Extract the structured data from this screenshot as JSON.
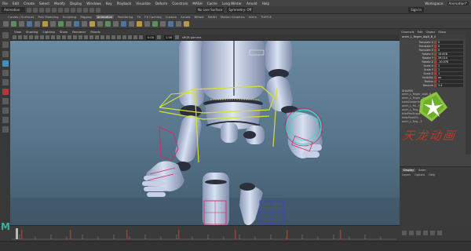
{
  "menubar": {
    "items": [
      "File",
      "Edit",
      "Create",
      "Select",
      "Modify",
      "Display",
      "Windows",
      "Key",
      "Playback",
      "Visualize",
      "Deform",
      "Constrain",
      "MASH",
      "Cache",
      "Long Winter",
      "Arnold",
      "Help"
    ],
    "workspace_label": "Workspace:",
    "workspace_value": "Animation*"
  },
  "statusline": {
    "mode": "Animation",
    "symmetry": "Symmetry: Off",
    "no_live": "No Live Surface",
    "sign_in": "Sign In"
  },
  "shelf": {
    "tabs": [
      "Curves / Surfaces",
      "Poly Modeling",
      "Sculpting",
      "Rigging",
      "Animation",
      "Rendering",
      "FX",
      "FX Caching",
      "Custom",
      "Arnold",
      "Bifrost",
      "MASH",
      "Motion Graphics",
      "XGen",
      "TURTLE"
    ],
    "active_index": 4
  },
  "viewport": {
    "menu": [
      "View",
      "Shading",
      "Lighting",
      "Show",
      "Renderer",
      "Panels"
    ],
    "exposure": "0.00",
    "gamma": "1.00",
    "colorspace": "sRGB gamma"
  },
  "channelbox": {
    "tabs": [
      "Channels",
      "Edit",
      "Object",
      "Show"
    ],
    "object_name": "anim_L_finger_digit_B_0",
    "attributes": [
      {
        "name": "Translate X",
        "value": "0"
      },
      {
        "name": "Translate Y",
        "value": "0"
      },
      {
        "name": "Translate Z",
        "value": "0"
      },
      {
        "name": "Rotate X",
        "value": "15.678"
      },
      {
        "name": "Rotate Y",
        "value": "39.014"
      },
      {
        "name": "Rotate Z",
        "value": "-10.078"
      },
      {
        "name": "Scale X",
        "value": "1"
      },
      {
        "name": "Scale Y",
        "value": "1"
      },
      {
        "name": "Scale Z",
        "value": "1"
      },
      {
        "name": "Visibility",
        "value": "on"
      },
      {
        "name": "Radius",
        "value": "1"
      },
      {
        "name": "Rescore",
        "value": "3.4"
      }
    ],
    "shapes_label": "SHAPES",
    "shape_name": "anim_L_finger_digit_B_0",
    "inputs": [
      "anim_L_finger_digit",
      "tddoClusterHandle",
      "anim_L_fin...twist",
      "anim_L_fing...twist",
      "tfdoPitnShape",
      "tddoPivot20...",
      "anim_L_fing...3"
    ]
  },
  "layers": {
    "tabs": [
      "Display",
      "Anim"
    ],
    "active_index": 0,
    "menu": [
      "Layers",
      "Options",
      "Help"
    ]
  },
  "watermark": {
    "text": "天龙动画"
  },
  "colors": {
    "accent": "#3fb0a0",
    "ctrl_yellow": "#d7e030",
    "ctrl_magenta": "#d02a6a",
    "ctrl_cyan": "#3fd8c8",
    "body": "#c8d4ea"
  },
  "icons": {
    "timeline_logo": "M"
  }
}
